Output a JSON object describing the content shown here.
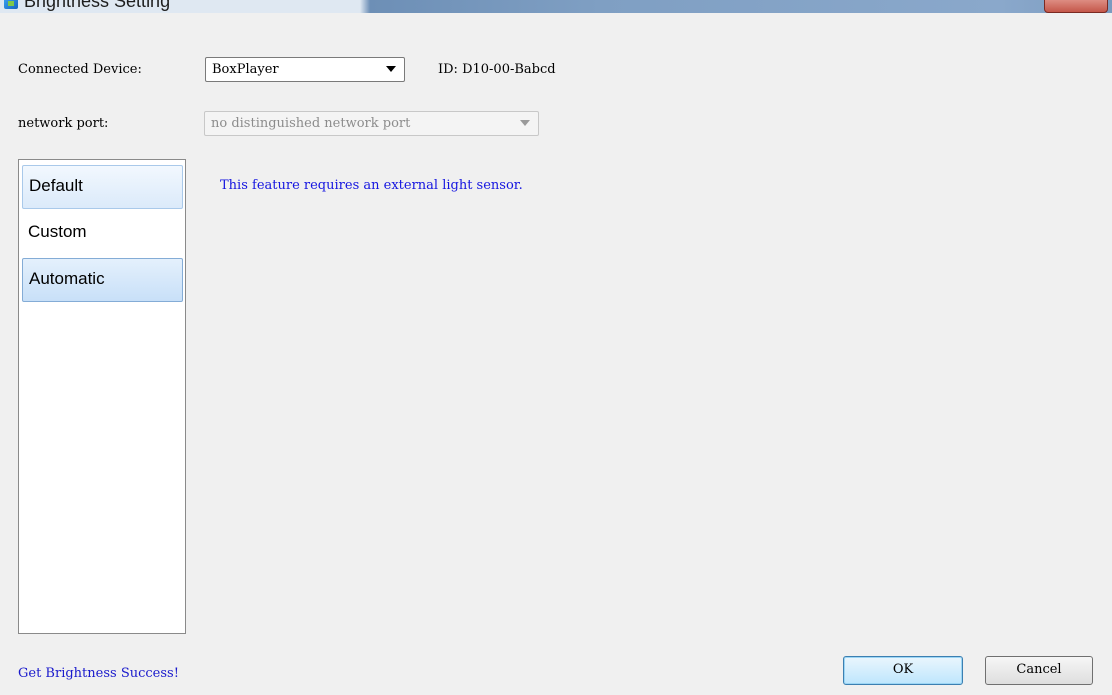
{
  "window": {
    "title": "Brightness Setting"
  },
  "device": {
    "label": "Connected Device:",
    "selected": "BoxPlayer",
    "id_text": "ID: D10-00-Babcd"
  },
  "network": {
    "label": "network port:",
    "selected": "no distinguished network port"
  },
  "sidebar": {
    "items": [
      {
        "label": "Default",
        "state": "hover"
      },
      {
        "label": "Custom",
        "state": "normal"
      },
      {
        "label": "Automatic",
        "state": "selected"
      }
    ]
  },
  "main": {
    "message": "This feature requires an external light sensor."
  },
  "status": {
    "text": "Get Brightness Success!"
  },
  "buttons": {
    "ok": "OK",
    "cancel": "Cancel"
  },
  "colors": {
    "message": "#1515e0",
    "status": "#1a1acc",
    "selection": "#c8e0f8"
  }
}
